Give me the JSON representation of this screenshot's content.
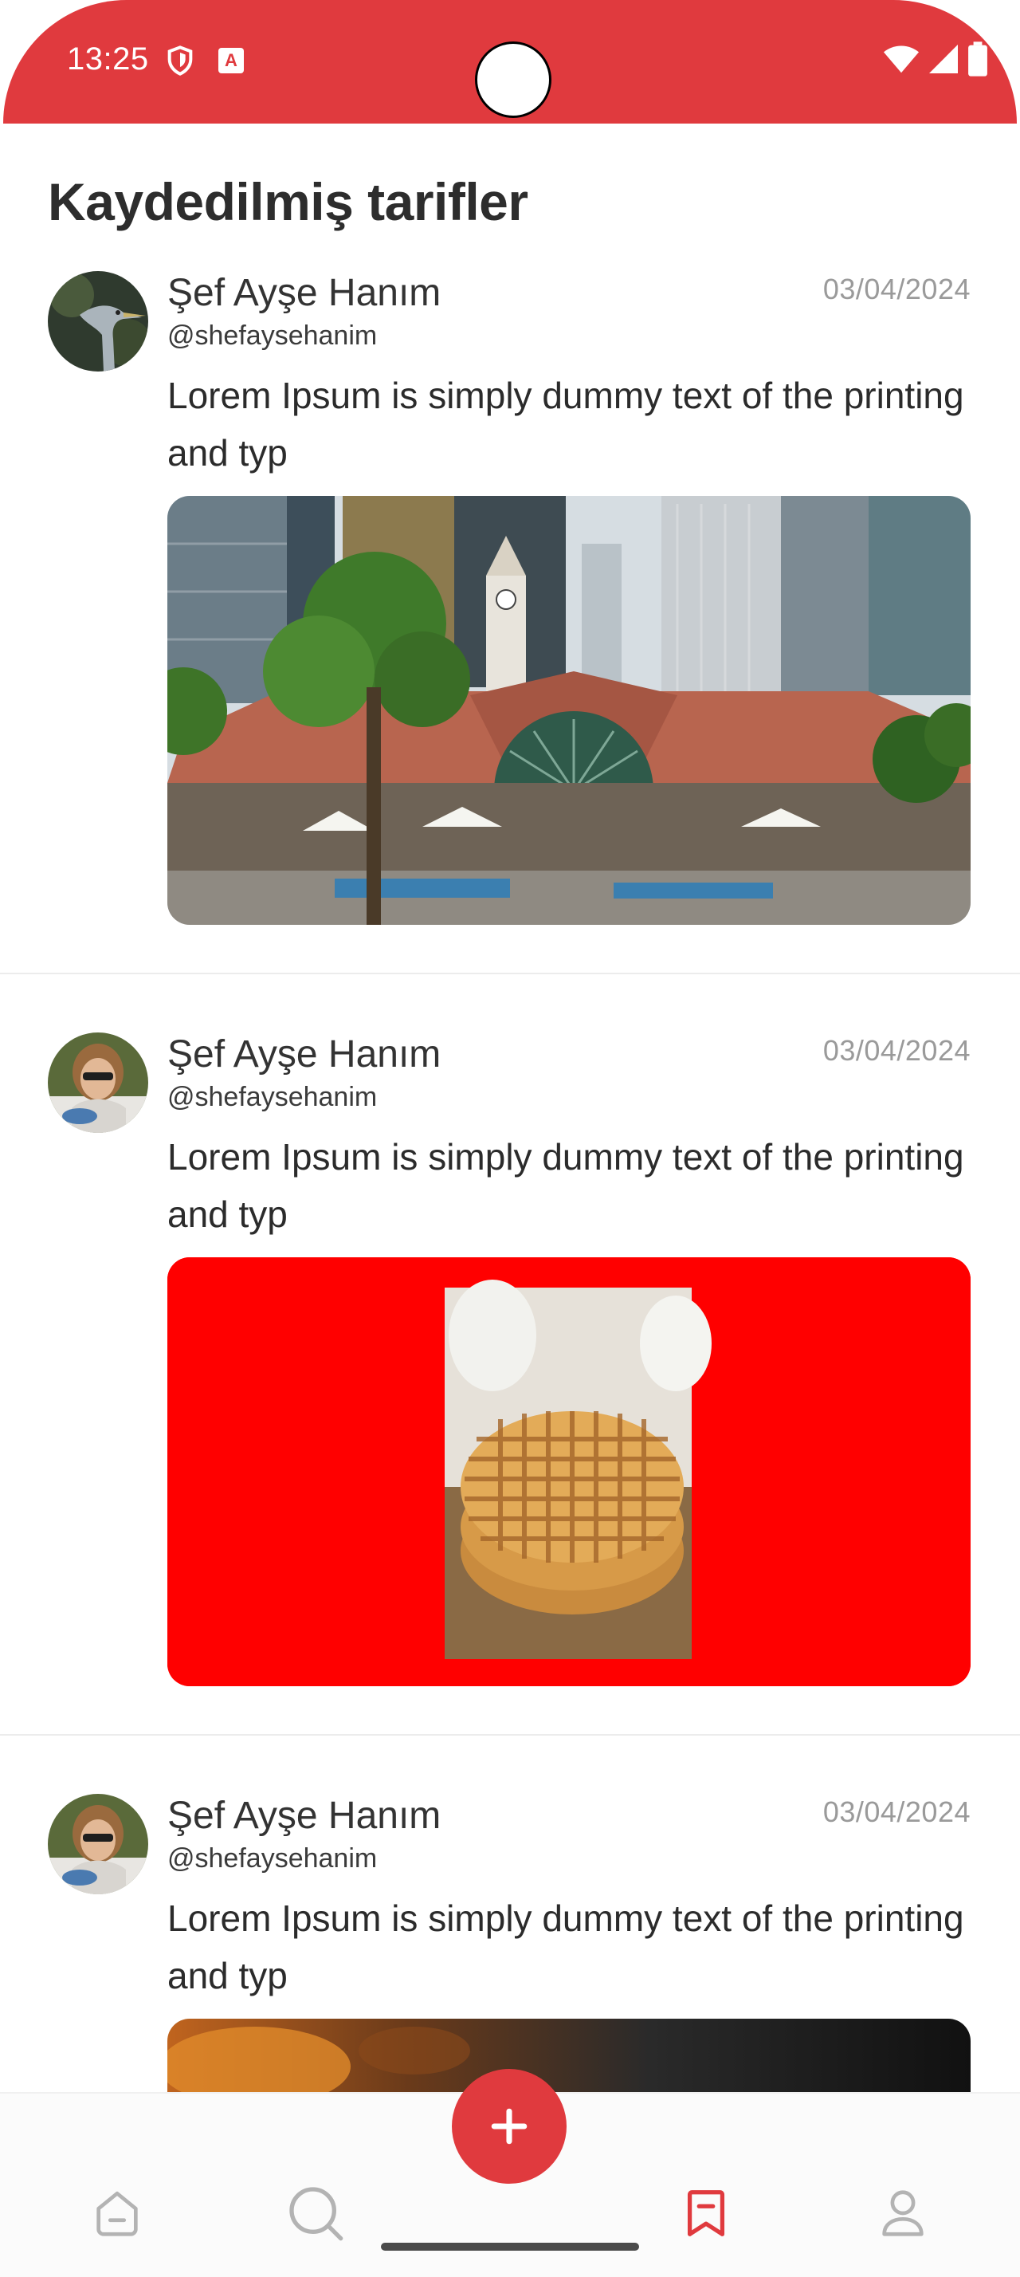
{
  "status_bar": {
    "time": "13:25"
  },
  "page": {
    "title": "Kaydedilmiş tarifler"
  },
  "posts": [
    {
      "author_name": "Şef Ayşe Hanım",
      "author_handle": "@shefaysehanim",
      "date": "03/04/2024",
      "text": "Lorem Ipsum is simply dummy text of the printing and typ"
    },
    {
      "author_name": "Şef Ayşe Hanım",
      "author_handle": "@shefaysehanim",
      "date": "03/04/2024",
      "text": "Lorem Ipsum is simply dummy text of the printing and typ"
    },
    {
      "author_name": "Şef Ayşe Hanım",
      "author_handle": "@shefaysehanim",
      "date": "03/04/2024",
      "text": "Lorem Ipsum is simply dummy text of the printing and typ"
    }
  ],
  "bottom_nav": {
    "items": [
      {
        "icon": "home-icon",
        "active": false
      },
      {
        "icon": "search-icon",
        "active": false
      },
      {
        "icon": "add-icon",
        "active": false
      },
      {
        "icon": "bookmark-icon",
        "active": true
      },
      {
        "icon": "profile-icon",
        "active": false
      }
    ]
  },
  "colors": {
    "accent": "#e03a3e",
    "inactive_icon": "#b3b3b3",
    "date_text": "#9a9a9a"
  }
}
